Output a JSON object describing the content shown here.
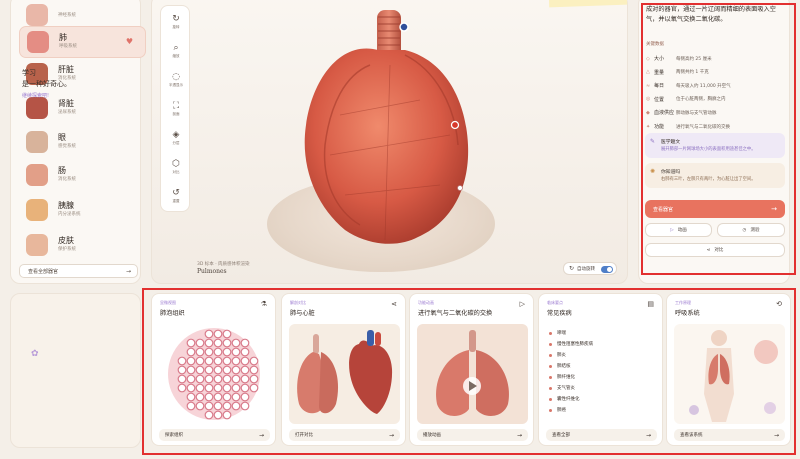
{
  "sidebar": {
    "items": [
      {
        "name": "",
        "system": "神经系统",
        "icon": "brain-icon",
        "color": "#e9b7a8"
      },
      {
        "name": "肺",
        "system": "呼吸系统",
        "icon": "lungs-icon",
        "color": "#e48d84",
        "active": true
      },
      {
        "name": "肝脏",
        "system": "消化系统",
        "icon": "liver-icon",
        "color": "#b8624b"
      },
      {
        "name": "肾脏",
        "system": "泌尿系统",
        "icon": "kidney-icon",
        "color": "#b55446"
      },
      {
        "name": "眼",
        "system": "感觉系统",
        "icon": "eye-icon",
        "color": "#d8b39b"
      },
      {
        "name": "肠",
        "system": "消化系统",
        "icon": "intestine-icon",
        "color": "#e29f88"
      },
      {
        "name": "胰腺",
        "system": "内分泌系统",
        "icon": "pancreas-icon",
        "color": "#e8b27a"
      },
      {
        "name": "皮肤",
        "system": "保护系统",
        "icon": "skin-icon",
        "color": "#e8b79c"
      }
    ],
    "view_all": "查看全部器官"
  },
  "toolbar": {
    "tools": [
      {
        "label": "旋转",
        "icon": "rotate-icon",
        "glyph": "↻"
      },
      {
        "label": "缩放",
        "icon": "zoom-icon",
        "glyph": "⌕"
      },
      {
        "label": "半透显示",
        "icon": "transparency-icon",
        "glyph": "◌"
      },
      {
        "label": "剖面",
        "icon": "section-icon",
        "glyph": "⛶"
      },
      {
        "label": "分层",
        "icon": "layers-icon",
        "glyph": "◈"
      },
      {
        "label": "对比",
        "icon": "compare-icon",
        "glyph": "⬡"
      },
      {
        "label": "重置",
        "icon": "reset-icon",
        "glyph": "↺"
      }
    ]
  },
  "viewer": {
    "caption_small": "3D 标本 · 肉质感体积渲染",
    "caption_latin": "Pulmones",
    "auto_rotate_label": "自动旋转",
    "auto_rotate_on": true
  },
  "info": {
    "description": "成对的器官，通过一片辽阔而精细的表面吸入空气，并以氧气交换二氧化碳。",
    "facts_heading": "关键数据",
    "facts": [
      {
        "icon": "shape-icon",
        "glyph": "◇",
        "key": "大小",
        "value": "每侧高约 25 厘米"
      },
      {
        "icon": "weight-icon",
        "glyph": "△",
        "key": "重量",
        "value": "两侧共约 1 千克"
      },
      {
        "icon": "wind-icon",
        "glyph": "≈",
        "key": "每日",
        "value": "每天吸入约 11,000 升空气"
      },
      {
        "icon": "location-icon",
        "glyph": "◎",
        "key": "位置",
        "value": "位于心脏两侧，胸廓之内"
      },
      {
        "icon": "blood-icon",
        "glyph": "◆",
        "key": "血液供应",
        "value": "肺动脉与支气管动脉"
      },
      {
        "icon": "function-icon",
        "glyph": "✦",
        "key": "功能",
        "value": "进行氧气与二氧化碳的交换"
      }
    ],
    "fun_fact_title": "医学趣文",
    "fun_fact_body": "展开肺部一片网球场大小的表面积用途甚佳之中。",
    "tip_title": "你知道吗",
    "tip_body": "右肺有三叶，左肺只有两叶，为心脏让出了空间。",
    "detail_button": "查看器官",
    "btn_animation": "动画",
    "btn_quiz": "测验",
    "btn_compare": "对比"
  },
  "quote": {
    "line1": "学习",
    "line2": "是一种好奇心。",
    "line3": "继续探索吧!"
  },
  "cards": [
    {
      "tag": "显微视图",
      "title": "肺泡组织",
      "icon": "flask-icon",
      "glyph": "⚗",
      "footer": "探索组织",
      "image": "alveoli-image"
    },
    {
      "tag": "解剖对比",
      "title": "肺与心脏",
      "icon": "share-icon",
      "glyph": "⋖",
      "footer": "打开对比",
      "image": "lungs-heart-image"
    },
    {
      "tag": "功能动画",
      "title": "进行氧气与二氧化碳的交换",
      "icon": "play-icon",
      "glyph": "▷",
      "footer": "播放动画",
      "image": "breathing-animation-image"
    },
    {
      "tag": "临床要点",
      "title": "常见疾病",
      "icon": "document-icon",
      "glyph": "▤",
      "footer": "查看全部",
      "diseases": [
        "哮喘",
        "慢性阻塞性肺疾病",
        "肺炎",
        "肺结核",
        "肺纤维化",
        "支气管炎",
        "囊性纤维化",
        "肺癌"
      ]
    },
    {
      "tag": "工作原理",
      "title": "呼吸系统",
      "icon": "breathing-icon",
      "glyph": "⟲",
      "footer": "查看该系统",
      "image": "respiratory-system-image"
    }
  ]
}
